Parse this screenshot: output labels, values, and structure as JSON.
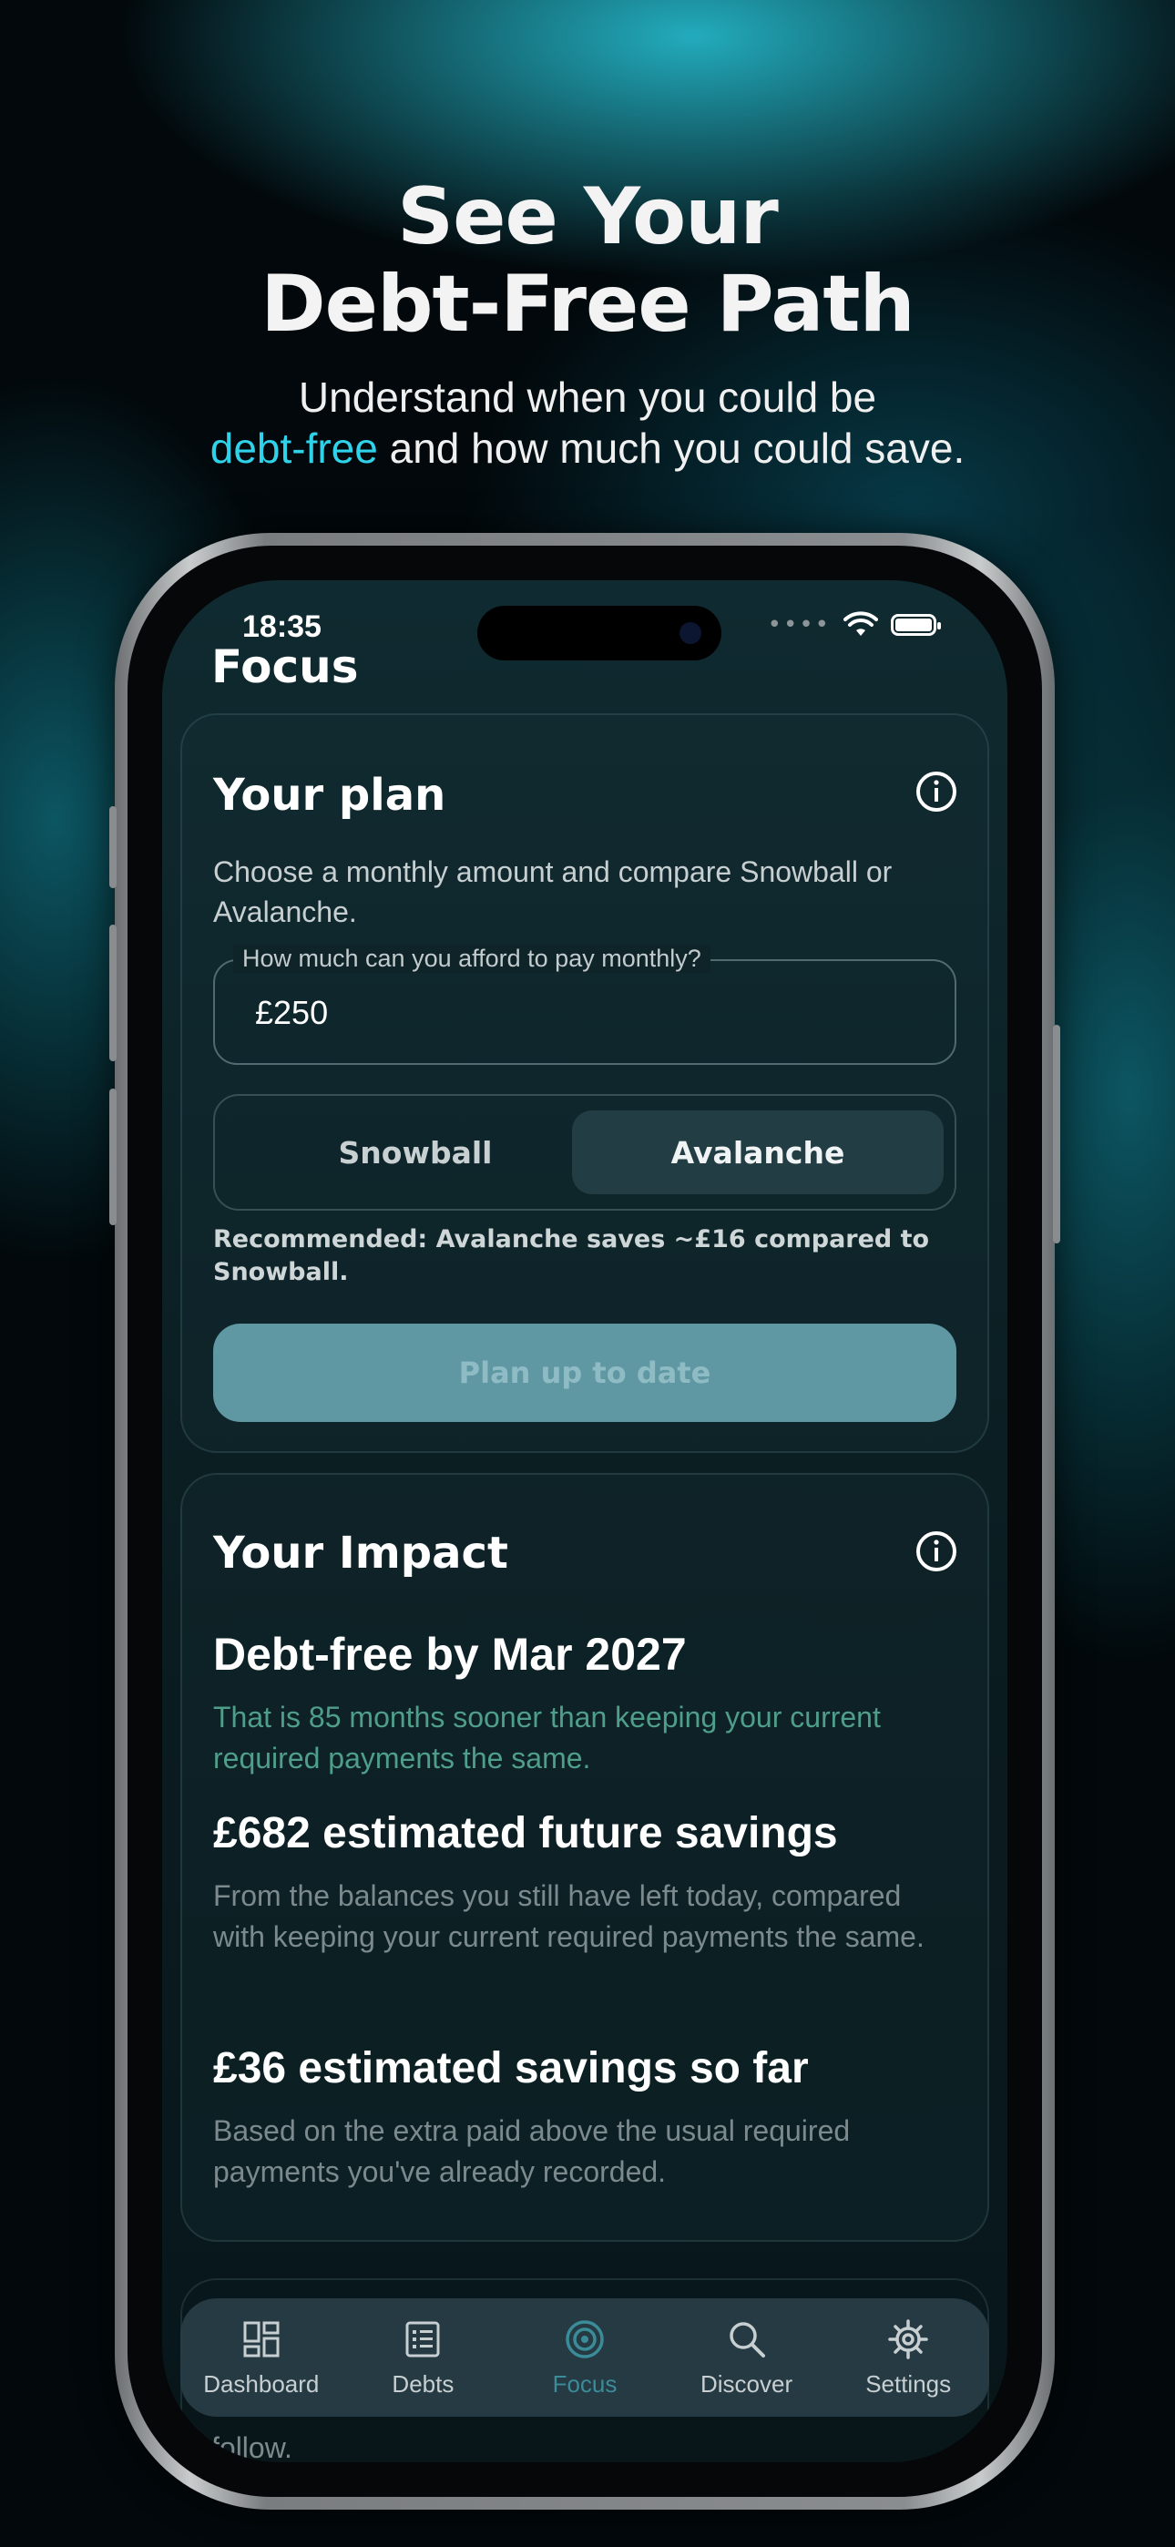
{
  "promo": {
    "headline_line1": "See Your",
    "headline_line2": "Debt-Free Path",
    "sub_line1": "Understand when you could be",
    "sub_accent": "debt-free",
    "sub_rest": " and how much you could save.",
    "accent_color": "#2fd2e8"
  },
  "status_bar": {
    "time": "18:35"
  },
  "page": {
    "title": "Focus"
  },
  "plan": {
    "title": "Your plan",
    "description": "Choose a monthly amount and compare Snowball or Avalanche.",
    "field_label": "How much can you afford to pay monthly?",
    "field_value": "£250",
    "options": [
      "Snowball",
      "Avalanche"
    ],
    "selected": "Avalanche",
    "recommendation": "Recommended: Avalanche saves ~£16 compared to Snowball.",
    "button_label": "Plan up to date"
  },
  "impact": {
    "title": "Your Impact",
    "debt_free_heading": "Debt-free by Mar 2027",
    "debt_free_text": "That is 85 months sooner than keeping your current required payments the same.",
    "future_savings_heading": "£682 estimated future savings",
    "future_savings_text": "From the balances you still have left today, compared with keeping your current required payments the same.",
    "so_far_heading": "£36 estimated savings so far",
    "so_far_text": "Based on the extra paid above the usual required payments you've already recorded."
  },
  "next_card": {
    "partial_text": "follow."
  },
  "tabbar": {
    "items": [
      {
        "label": "Dashboard",
        "icon": "dashboard-icon"
      },
      {
        "label": "Debts",
        "icon": "list-icon"
      },
      {
        "label": "Focus",
        "icon": "focus-target-icon"
      },
      {
        "label": "Discover",
        "icon": "search-icon"
      },
      {
        "label": "Settings",
        "icon": "gear-icon"
      }
    ],
    "active": "Focus",
    "active_color": "#3c8b98"
  }
}
